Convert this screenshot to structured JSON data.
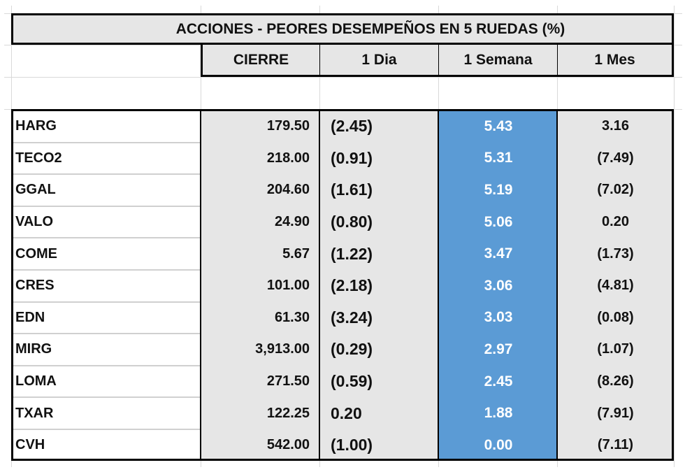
{
  "title": "ACCIONES   - PEORES DESEMPEÑOS EN 5 RUEDAS (%)",
  "headers": {
    "cierre": "CIERRE",
    "dia": "1 Dia",
    "semana": "1 Semana",
    "mes": "1 Mes"
  },
  "colors": {
    "header_bg": "#e6e6e6",
    "highlight_column": "#5b9bd5",
    "border": "#000000"
  },
  "rows": [
    {
      "ticker": "HARG",
      "cierre": "179.50",
      "dia": "(2.45)",
      "semana": "5.43",
      "mes": "3.16"
    },
    {
      "ticker": "TECO2",
      "cierre": "218.00",
      "dia": "(0.91)",
      "semana": "5.31",
      "mes": "(7.49)"
    },
    {
      "ticker": "GGAL",
      "cierre": "204.60",
      "dia": "(1.61)",
      "semana": "5.19",
      "mes": "(7.02)"
    },
    {
      "ticker": "VALO",
      "cierre": "24.90",
      "dia": "(0.80)",
      "semana": "5.06",
      "mes": "0.20"
    },
    {
      "ticker": "COME",
      "cierre": "5.67",
      "dia": "(1.22)",
      "semana": "3.47",
      "mes": "(1.73)"
    },
    {
      "ticker": "CRES",
      "cierre": "101.00",
      "dia": "(2.18)",
      "semana": "3.06",
      "mes": "(4.81)"
    },
    {
      "ticker": "EDN",
      "cierre": "61.30",
      "dia": "(3.24)",
      "semana": "3.03",
      "mes": "(0.08)"
    },
    {
      "ticker": "MIRG",
      "cierre": "3,913.00",
      "dia": "(0.29)",
      "semana": "2.97",
      "mes": "(1.07)"
    },
    {
      "ticker": "LOMA",
      "cierre": "271.50",
      "dia": "(0.59)",
      "semana": "2.45",
      "mes": "(8.26)"
    },
    {
      "ticker": "TXAR",
      "cierre": "122.25",
      "dia": "0.20",
      "semana": "1.88",
      "mes": "(7.91)"
    },
    {
      "ticker": "CVH",
      "cierre": "542.00",
      "dia": "(1.00)",
      "semana": "0.00",
      "mes": "(7.11)"
    }
  ]
}
